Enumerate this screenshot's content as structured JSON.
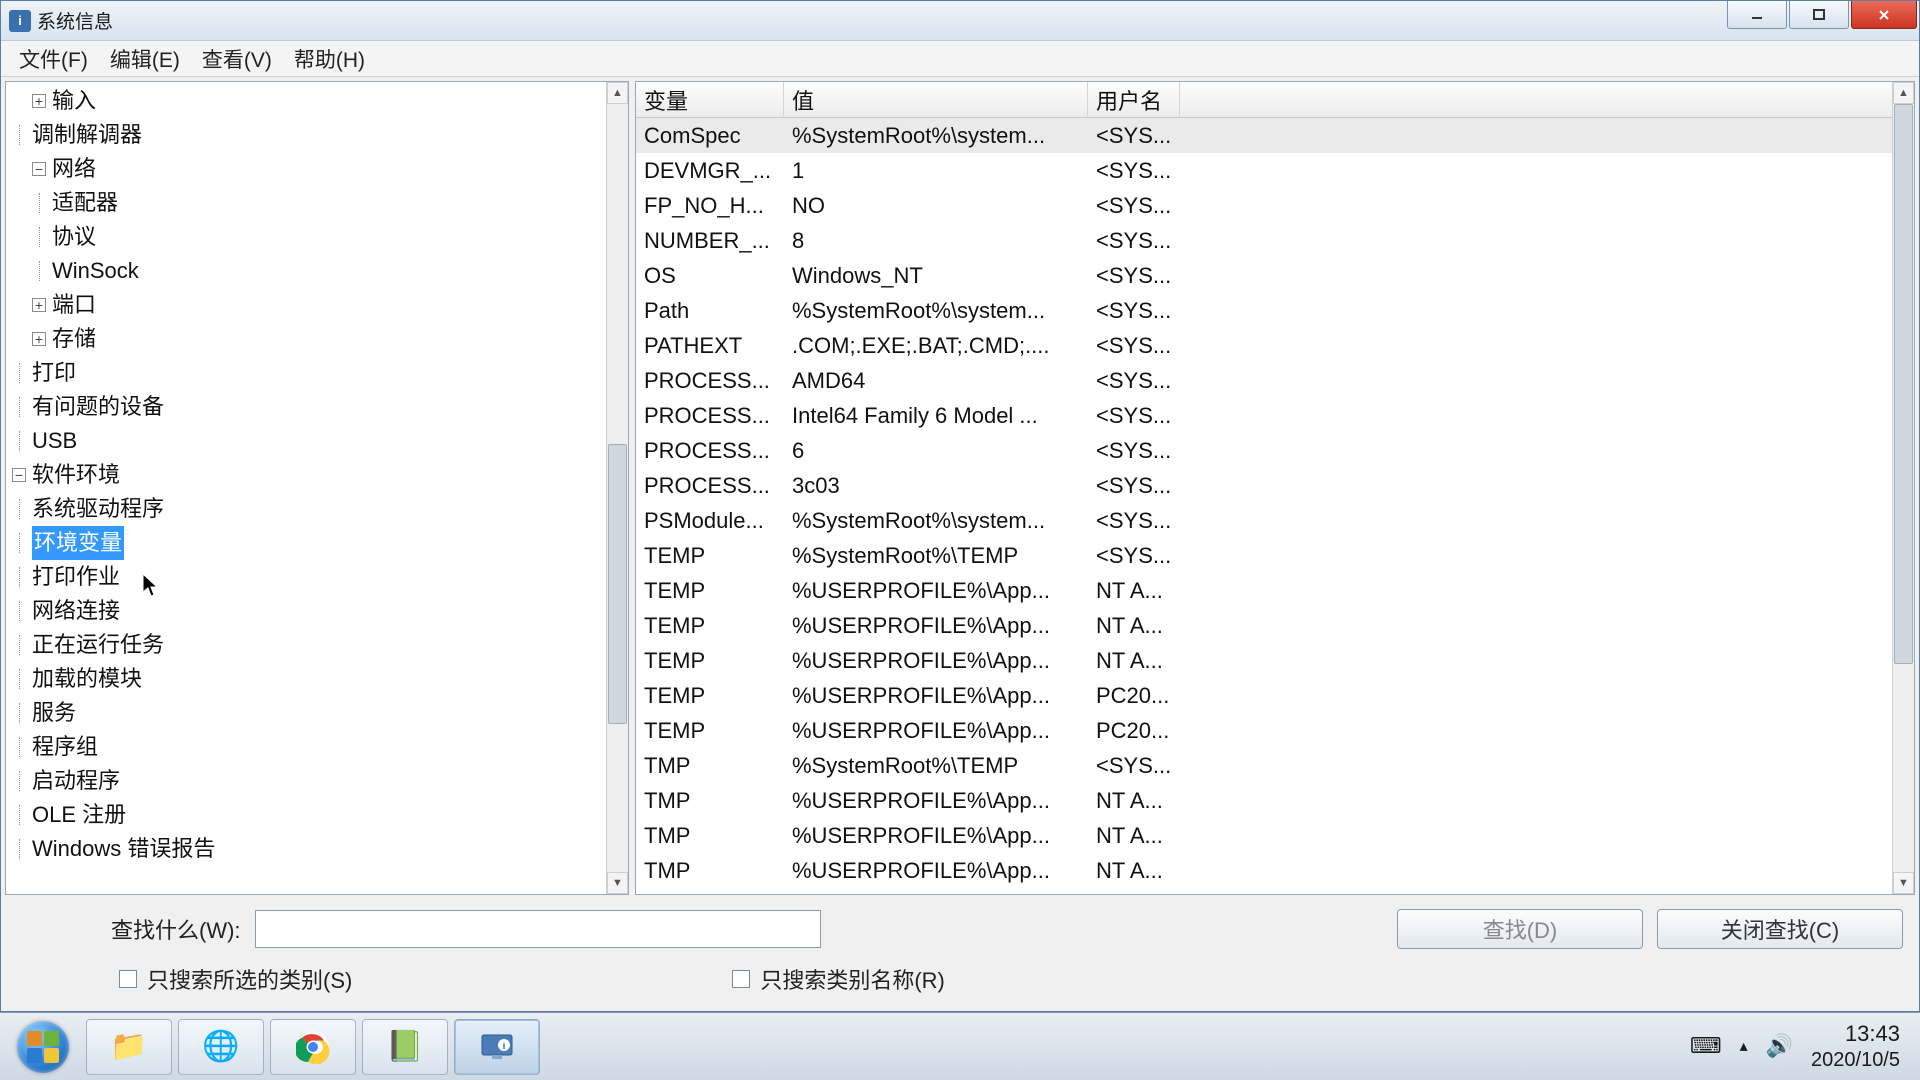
{
  "window": {
    "title": "系统信息"
  },
  "menus": [
    "文件(F)",
    "编辑(E)",
    "查看(V)",
    "帮助(H)"
  ],
  "tree": {
    "top": [
      {
        "label": "输入",
        "expander": "+",
        "indent": 1
      },
      {
        "label": "调制解调器",
        "expander": "",
        "indent": 1
      },
      {
        "label": "网络",
        "expander": "-",
        "indent": 1
      },
      {
        "label": "适配器",
        "expander": "",
        "indent": 2
      },
      {
        "label": "协议",
        "expander": "",
        "indent": 2
      },
      {
        "label": "WinSock",
        "expander": "",
        "indent": 2
      },
      {
        "label": "端口",
        "expander": "+",
        "indent": 1
      },
      {
        "label": "存储",
        "expander": "+",
        "indent": 1
      },
      {
        "label": "打印",
        "expander": "",
        "indent": 1
      },
      {
        "label": "有问题的设备",
        "expander": "",
        "indent": 1
      },
      {
        "label": "USB",
        "expander": "",
        "indent": 1
      },
      {
        "label": "软件环境",
        "expander": "-",
        "indent": 0
      },
      {
        "label": "系统驱动程序",
        "expander": "",
        "indent": 1
      },
      {
        "label": "环境变量",
        "expander": "",
        "indent": 1,
        "selected": true
      },
      {
        "label": "打印作业",
        "expander": "",
        "indent": 1
      },
      {
        "label": "网络连接",
        "expander": "",
        "indent": 1
      },
      {
        "label": "正在运行任务",
        "expander": "",
        "indent": 1
      },
      {
        "label": "加载的模块",
        "expander": "",
        "indent": 1
      },
      {
        "label": "服务",
        "expander": "",
        "indent": 1
      },
      {
        "label": "程序组",
        "expander": "",
        "indent": 1
      },
      {
        "label": "启动程序",
        "expander": "",
        "indent": 1
      },
      {
        "label": "OLE 注册",
        "expander": "",
        "indent": 1
      },
      {
        "label": "Windows 错误报告",
        "expander": "",
        "indent": 1
      }
    ]
  },
  "table": {
    "columns": [
      "变量",
      "值",
      "用户名"
    ],
    "rows": [
      {
        "c0": "ComSpec",
        "c1": "%SystemRoot%\\system...",
        "c2": "<SYS...",
        "sel": true
      },
      {
        "c0": "DEVMGR_...",
        "c1": "1",
        "c2": "<SYS..."
      },
      {
        "c0": "FP_NO_H...",
        "c1": "NO",
        "c2": "<SYS..."
      },
      {
        "c0": "NUMBER_...",
        "c1": "8",
        "c2": "<SYS..."
      },
      {
        "c0": "OS",
        "c1": "Windows_NT",
        "c2": "<SYS..."
      },
      {
        "c0": "Path",
        "c1": "%SystemRoot%\\system...",
        "c2": "<SYS..."
      },
      {
        "c0": "PATHEXT",
        "c1": ".COM;.EXE;.BAT;.CMD;....",
        "c2": "<SYS..."
      },
      {
        "c0": "PROCESS...",
        "c1": "AMD64",
        "c2": "<SYS..."
      },
      {
        "c0": "PROCESS...",
        "c1": "Intel64 Family 6 Model ...",
        "c2": "<SYS..."
      },
      {
        "c0": "PROCESS...",
        "c1": "6",
        "c2": "<SYS..."
      },
      {
        "c0": "PROCESS...",
        "c1": "3c03",
        "c2": "<SYS..."
      },
      {
        "c0": "PSModule...",
        "c1": "%SystemRoot%\\system...",
        "c2": "<SYS..."
      },
      {
        "c0": "TEMP",
        "c1": "%SystemRoot%\\TEMP",
        "c2": "<SYS..."
      },
      {
        "c0": "TEMP",
        "c1": "%USERPROFILE%\\App...",
        "c2": "NT A..."
      },
      {
        "c0": "TEMP",
        "c1": "%USERPROFILE%\\App...",
        "c2": "NT A..."
      },
      {
        "c0": "TEMP",
        "c1": "%USERPROFILE%\\App...",
        "c2": "NT A..."
      },
      {
        "c0": "TEMP",
        "c1": "%USERPROFILE%\\App...",
        "c2": "PC20..."
      },
      {
        "c0": "TEMP",
        "c1": "%USERPROFILE%\\App...",
        "c2": "PC20..."
      },
      {
        "c0": "TMP",
        "c1": "%SystemRoot%\\TEMP",
        "c2": "<SYS..."
      },
      {
        "c0": "TMP",
        "c1": "%USERPROFILE%\\App...",
        "c2": "NT A..."
      },
      {
        "c0": "TMP",
        "c1": "%USERPROFILE%\\App...",
        "c2": "NT A..."
      },
      {
        "c0": "TMP",
        "c1": "%USERPROFILE%\\App...",
        "c2": "NT A..."
      }
    ]
  },
  "search": {
    "label": "查找什么(W):",
    "find_btn": "查找(D)",
    "close_btn": "关闭查找(C)",
    "chk1": "只搜索所选的类别(S)",
    "chk2": "只搜索类别名称(R)"
  },
  "taskbar": {
    "time": "13:43",
    "date": "2020/10/5"
  }
}
